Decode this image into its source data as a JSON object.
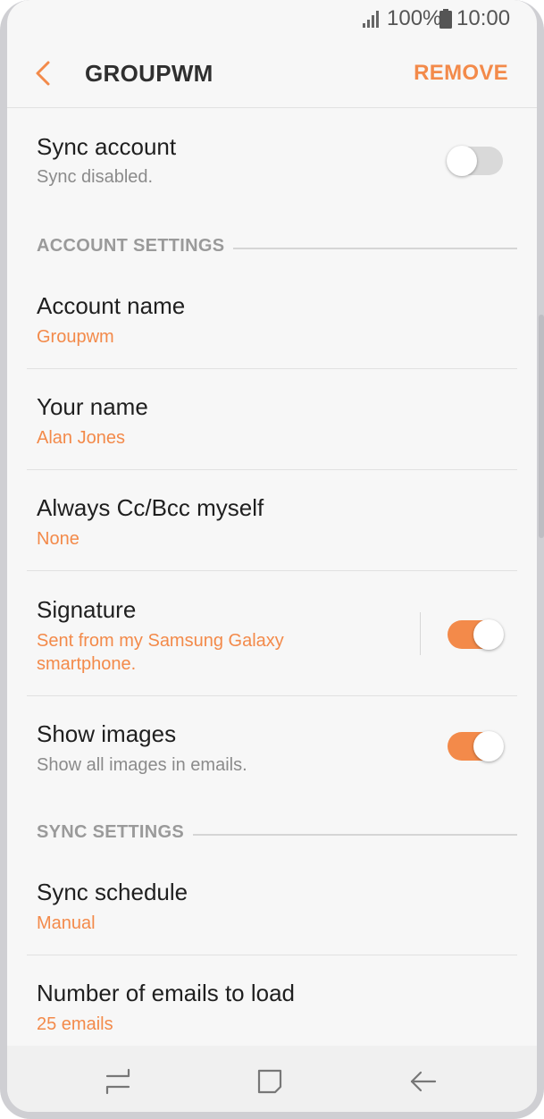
{
  "status_bar": {
    "battery_percent": "100%",
    "time": "10:00"
  },
  "app_bar": {
    "title": "GROUPWM",
    "action": "REMOVE"
  },
  "sync_account": {
    "title": "Sync account",
    "subtitle": "Sync disabled.",
    "enabled": false
  },
  "account_settings": {
    "header": "ACCOUNT SETTINGS",
    "account_name": {
      "title": "Account name",
      "value": "Groupwm"
    },
    "your_name": {
      "title": "Your name",
      "value": "Alan Jones"
    },
    "cc_bcc": {
      "title": "Always Cc/Bcc myself",
      "value": "None"
    },
    "signature": {
      "title": "Signature",
      "value_line1": "Sent from my Samsung Galaxy",
      "value_line2": "smartphone.",
      "enabled": true
    },
    "show_images": {
      "title": "Show images",
      "subtitle": "Show all images in emails.",
      "enabled": true
    }
  },
  "sync_settings": {
    "header": "SYNC SETTINGS",
    "sync_schedule": {
      "title": "Sync schedule",
      "value": "Manual"
    },
    "emails_to_load": {
      "title": "Number of emails to load",
      "value": "25 emails"
    }
  },
  "colors": {
    "accent": "#f38a4a",
    "background": "#f7f7f7"
  },
  "icons": [
    "signal-icon",
    "battery-icon",
    "back-arrow-icon",
    "recent-apps-icon",
    "home-icon",
    "back-icon"
  ]
}
